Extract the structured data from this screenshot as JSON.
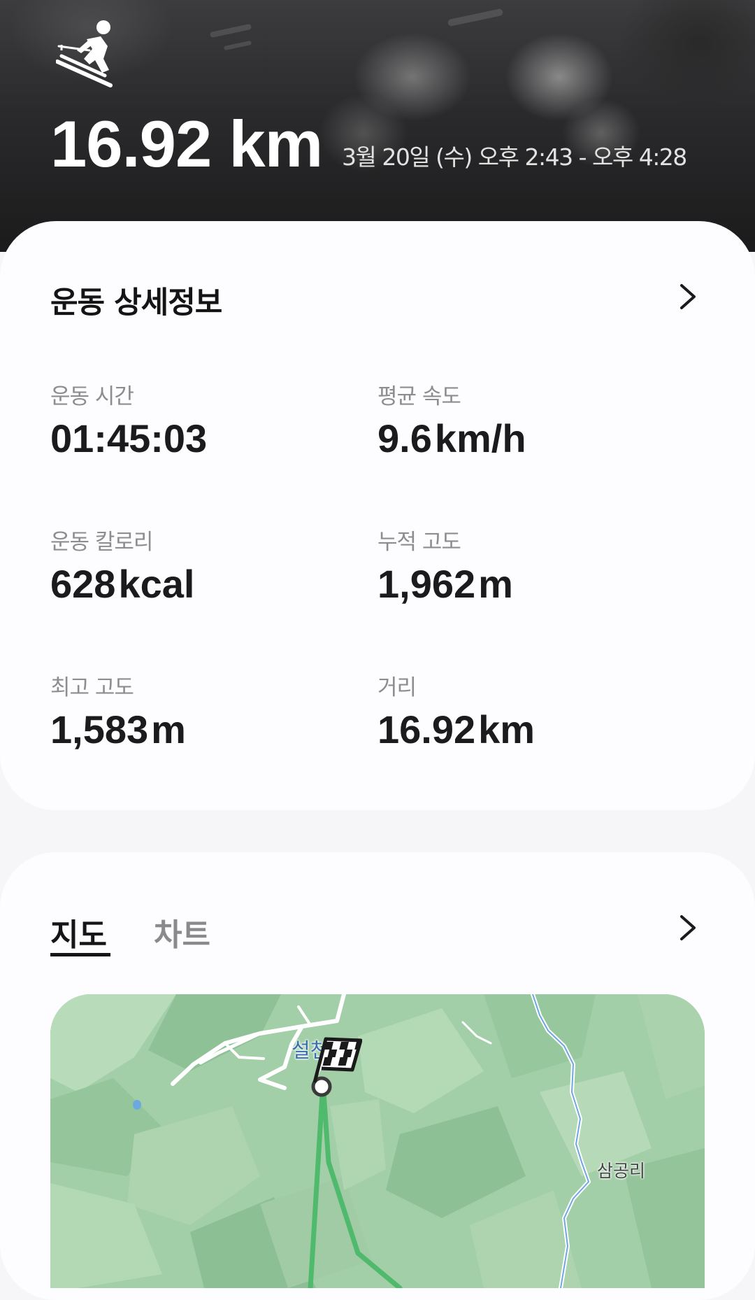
{
  "header": {
    "activity_icon": "skiing-icon",
    "distance": "16.92 km",
    "datetime": "3월 20일 (수) 오후 2:43 - 오후 4:28"
  },
  "details": {
    "title": "운동 상세정보",
    "more_icon": "chevron-right-icon",
    "stats": [
      {
        "label": "운동 시간",
        "value": "01:45:03",
        "unit": ""
      },
      {
        "label": "평균 속도",
        "value": "9.6",
        "unit": "km/h"
      },
      {
        "label": "운동 칼로리",
        "value": "628",
        "unit": "kcal"
      },
      {
        "label": "누적 고도",
        "value": "1,962",
        "unit": "m"
      },
      {
        "label": "최고 고도",
        "value": "1,583",
        "unit": "m"
      },
      {
        "label": "거리",
        "value": "16.92",
        "unit": "km"
      }
    ]
  },
  "map_section": {
    "tabs": [
      {
        "label": "지도",
        "selected": true
      },
      {
        "label": "차트",
        "selected": false
      }
    ],
    "more_icon": "chevron-right-icon",
    "map": {
      "place_label": "설천",
      "village_label": "삼공리",
      "finish_icon": "checkered-flag-icon",
      "start_icon": "start-point-icon",
      "route_color": "#4fba6b"
    }
  }
}
